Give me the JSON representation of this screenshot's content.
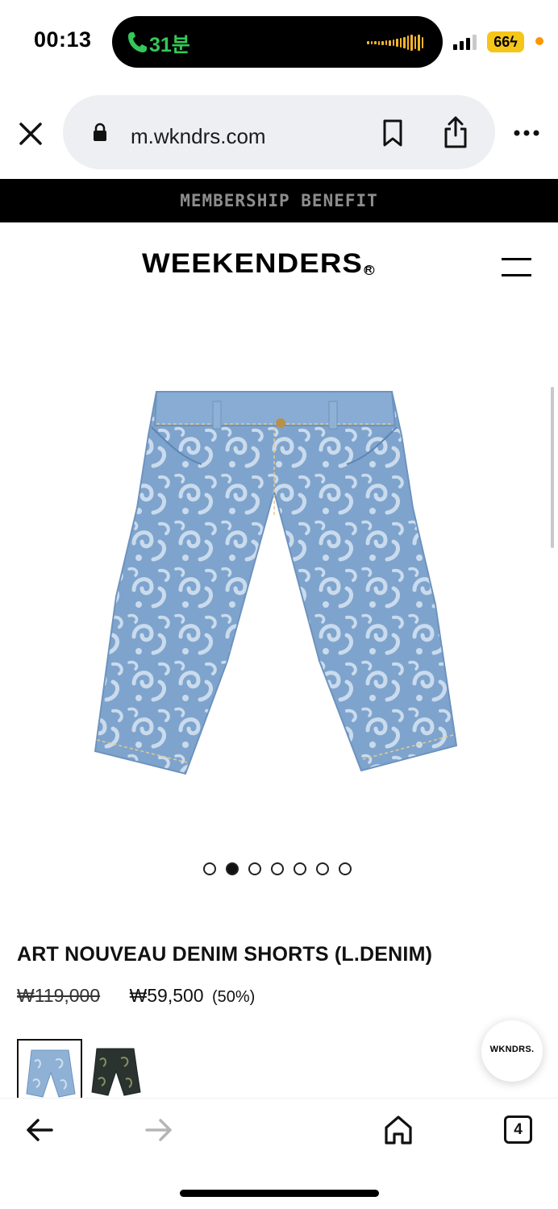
{
  "status_bar": {
    "time": "00:13",
    "call_duration": "31분",
    "battery": "66"
  },
  "browser": {
    "url": "m.wkndrs.com",
    "open_tabs": "4"
  },
  "site": {
    "promo_banner": "MEMBERSHIP BENEFIT",
    "brand": "WEEKENDERS",
    "floating_badge": "WKNDRS."
  },
  "product": {
    "title": "ART NOUVEAU DENIM SHORTS (L.DENIM)",
    "price_original": "₩119,000",
    "price_sale": "₩59,500",
    "discount": "(50%)",
    "image_count": 7,
    "active_image": 2,
    "swatches": [
      "light-denim",
      "black-denim"
    ]
  },
  "colors": {
    "denim_base": "#7fa5cf",
    "denim_pattern": "#c9daec",
    "banner_bg": "#000000",
    "call_green": "#34c759",
    "battery_yellow": "#f5c518"
  },
  "icons": [
    "phone-icon",
    "close-icon",
    "lock-icon",
    "bookmark-icon",
    "share-icon",
    "more-icon",
    "menu-icon",
    "back-arrow-icon",
    "forward-arrow-icon",
    "home-icon",
    "tabs-icon"
  ]
}
